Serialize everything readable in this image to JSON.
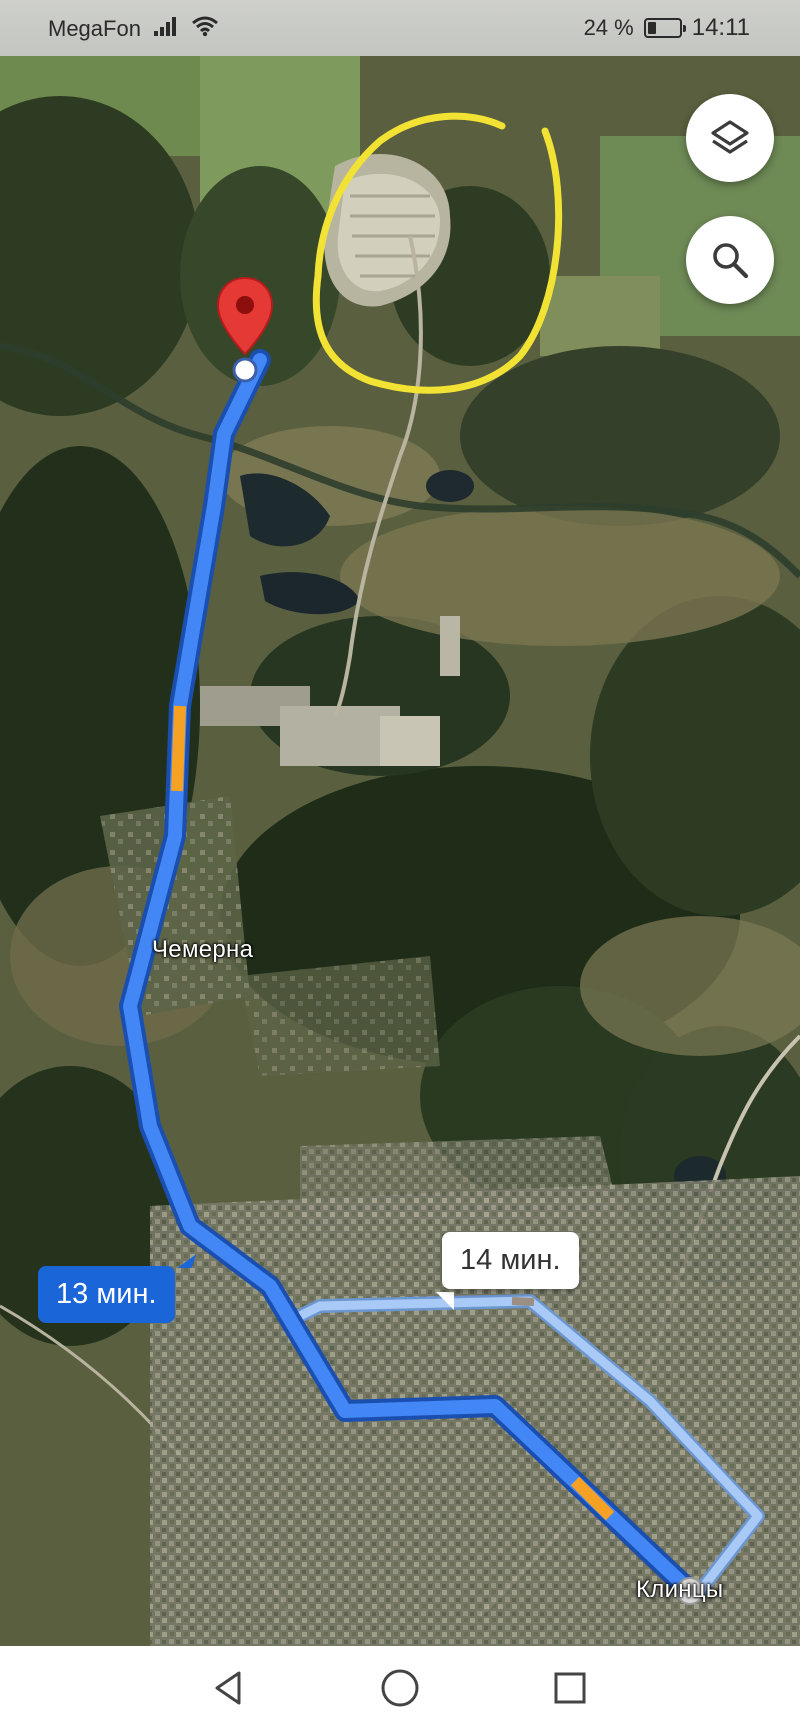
{
  "status_bar": {
    "carrier": "MegaFon",
    "battery_text": "24 %",
    "battery_level": 0.24,
    "time": "14:11",
    "icons": [
      "signal-icon",
      "wifi-icon",
      "battery-icon"
    ]
  },
  "map": {
    "type": "satellite",
    "labels": {
      "village": "Чемерна",
      "town": "Клинцы"
    },
    "route": {
      "primary_eta": "13 мин.",
      "alternate_eta": "14 мин."
    },
    "controls": {
      "layers_icon": "layers-icon",
      "search_icon": "search-icon"
    },
    "destination_marker_icon": "location-pin-icon",
    "colors": {
      "route_primary": "#1a66d8",
      "route_primary_fill": "#4287f5",
      "route_alternate": "#a9c9f7",
      "traffic_slow": "#f4a124",
      "pin": "#e53935",
      "annotation": "#f2e233"
    }
  },
  "nav_bar": {
    "back_icon": "back-triangle-icon",
    "home_icon": "home-circle-icon",
    "recents_icon": "recents-square-icon"
  }
}
